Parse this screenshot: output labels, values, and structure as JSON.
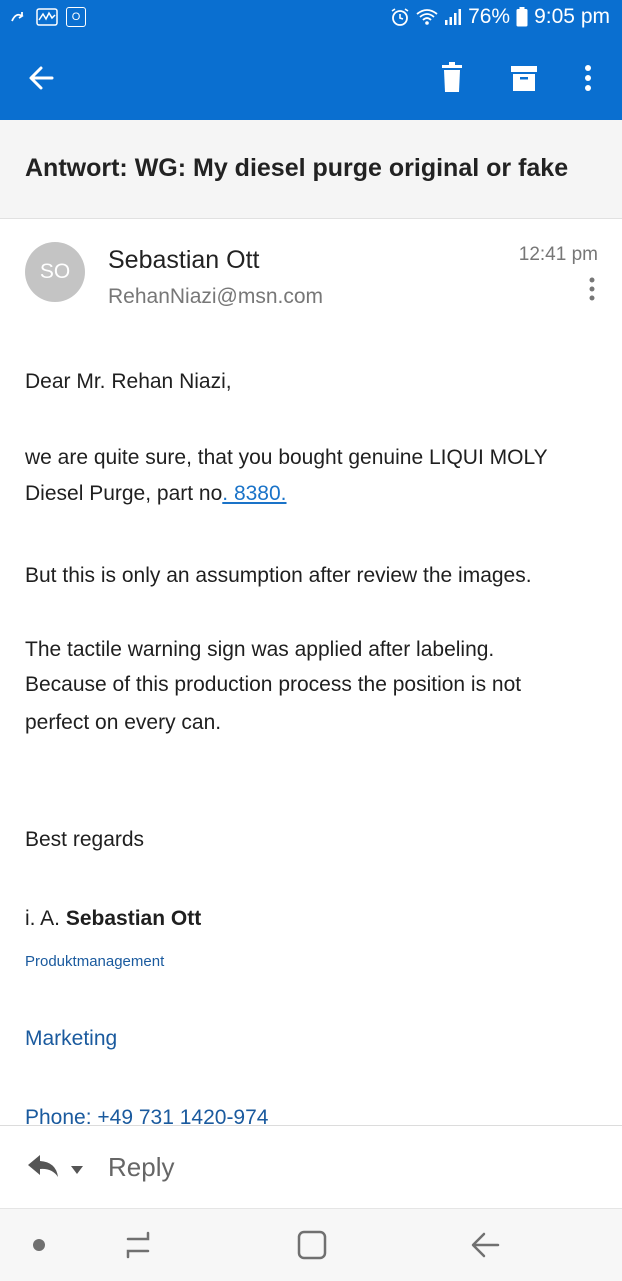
{
  "status_bar": {
    "battery": "76%",
    "time": "9:05 pm",
    "notification_icons": [
      "arrow-icon",
      "activity-icon",
      "outlook-icon"
    ],
    "system_icons": [
      "alarm-icon",
      "wifi-icon",
      "signal-icon",
      "battery-icon"
    ]
  },
  "toolbar": {
    "icons": [
      "back-arrow-icon",
      "trash-icon",
      "archive-icon",
      "more-vertical-icon"
    ]
  },
  "email": {
    "subject": "Antwort: WG: My diesel purge original or fake",
    "sender": {
      "initials": "SO",
      "name": "Sebastian Ott",
      "email": "RehanNiazi@msn.com"
    },
    "time": "12:41 pm",
    "body": {
      "greeting": "Dear Mr. Rehan Niazi,",
      "p1_line1": "we are quite sure, that you bought genuine LIQUI MOLY",
      "p1_line2_prefix": "Diesel Purge, part no",
      "p1_link": ". 8380.",
      "p2": "But this is only an assumption after review the images.",
      "p3_line1": "The tactile warning sign was applied after labeling.",
      "p3_line2": "Because of this production process the position is not",
      "p3_line3": "perfect on every can.",
      "closing": "Best regards",
      "sig_prefix": "i. A. ",
      "sig_name": "Sebastian Ott",
      "department": "Produktmanagement",
      "division": "Marketing",
      "phone": "Phone: +49 731 1420-974"
    }
  },
  "reply_bar": {
    "label": "Reply"
  },
  "colors": {
    "brand": "#0a6fd0",
    "link": "#1a73c8",
    "signature_blue": "#1a5a9e"
  }
}
